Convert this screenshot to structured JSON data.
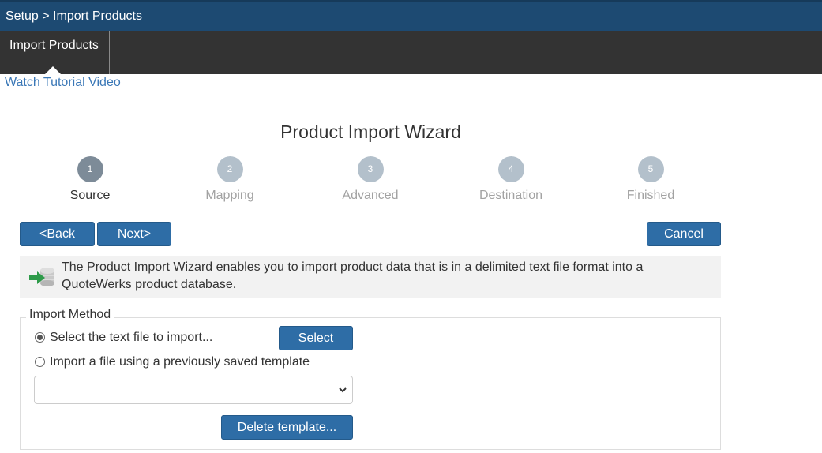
{
  "breadcrumb": "Setup > Import Products",
  "tabs": [
    {
      "label": "Import Products",
      "active": true
    }
  ],
  "tutorial_link": "Watch Tutorial Video",
  "wizard": {
    "title": "Product Import Wizard",
    "steps": [
      {
        "number": "1",
        "label": "Source",
        "active": true
      },
      {
        "number": "2",
        "label": "Mapping",
        "active": false
      },
      {
        "number": "3",
        "label": "Advanced",
        "active": false
      },
      {
        "number": "4",
        "label": "Destination",
        "active": false
      },
      {
        "number": "5",
        "label": "Finished",
        "active": false
      }
    ]
  },
  "nav": {
    "back_label": "<Back",
    "next_label": "Next>",
    "cancel_label": "Cancel"
  },
  "info": {
    "icon": "import-database-icon",
    "text": "The Product Import Wizard enables you to import product data that is in a delimited text file format into a QuoteWerks product database."
  },
  "import_method": {
    "legend": "Import Method",
    "option_file": "Select the text file to import...",
    "option_template": "Import a file using a previously saved template",
    "selected": "file",
    "select_button": "Select",
    "template_value": "",
    "delete_template_button": "Delete template..."
  },
  "colors": {
    "header_bg": "#1d4a72",
    "tabbar_bg": "#333333",
    "button_bg": "#2e6da6",
    "link": "#3b78b7",
    "step_active": "#7d8b98",
    "step_inactive": "#b3c0cb"
  }
}
